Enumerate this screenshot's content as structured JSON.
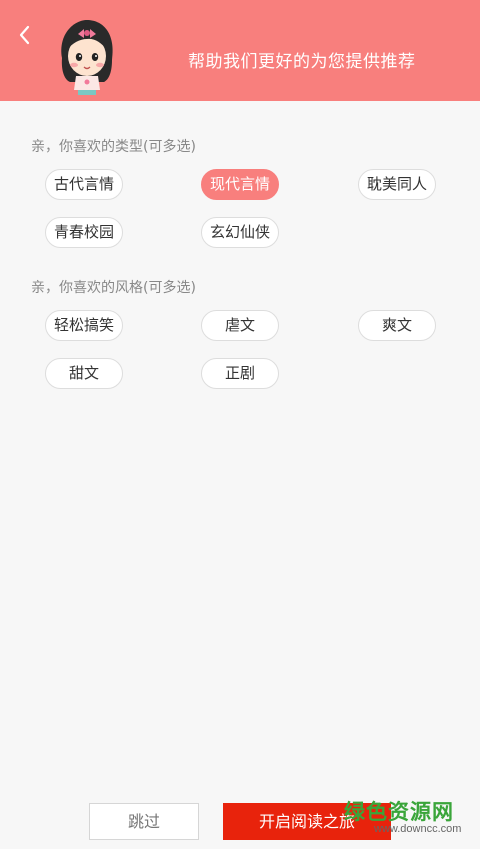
{
  "header": {
    "title": "帮助我们更好的为您提供推荐",
    "background_color": "#f87f7d",
    "back_icon": "chevron-left-icon",
    "avatar_icon": "girl-avatar-icon"
  },
  "genre_section": {
    "title": "亲，你喜欢的类型(可多选)",
    "tags": [
      {
        "label": "古代言情",
        "selected": false
      },
      {
        "label": "现代言情",
        "selected": true
      },
      {
        "label": "耽美同人",
        "selected": false
      },
      {
        "label": "青春校园",
        "selected": false
      },
      {
        "label": "玄幻仙侠",
        "selected": false
      }
    ]
  },
  "style_section": {
    "title": "亲，你喜欢的风格(可多选)",
    "tags": [
      {
        "label": "轻松搞笑",
        "selected": false
      },
      {
        "label": "虐文",
        "selected": false
      },
      {
        "label": "爽文",
        "selected": false
      },
      {
        "label": "甜文",
        "selected": false
      },
      {
        "label": "正剧",
        "selected": false
      }
    ]
  },
  "footer": {
    "skip_label": "跳过",
    "start_label": "开启阅读之旅",
    "start_color": "#e8230c"
  },
  "watermark": {
    "main": "绿色资源网",
    "sub": "www.downcc.com"
  }
}
